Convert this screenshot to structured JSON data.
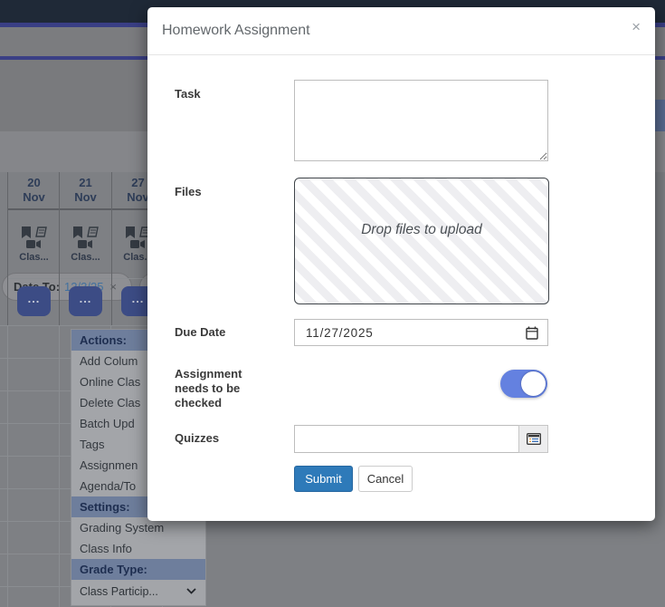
{
  "modal": {
    "title": "Homework Assignment",
    "close_label": "×",
    "task": {
      "label": "Task",
      "value": ""
    },
    "files": {
      "label": "Files",
      "dropzone_text": "Drop files to upload"
    },
    "due_date": {
      "label": "Due Date",
      "value": "11/27/2025"
    },
    "needs_check": {
      "label": "Assignment needs to be checked",
      "state": "on"
    },
    "quizzes": {
      "label": "Quizzes",
      "value": ""
    },
    "submit_label": "Submit",
    "cancel_label": "Cancel",
    "colors": {
      "primary": "#2e7ab9",
      "toggle_on": "#6481e0"
    }
  },
  "background": {
    "filter_chip": {
      "label": "Date To:",
      "value": "12/3/25",
      "remove": "×"
    },
    "columns": [
      {
        "day": "20",
        "month": "Nov",
        "class_label": "Clas...",
        "more": "..."
      },
      {
        "day": "21",
        "month": "Nov",
        "class_label": "Clas...",
        "more": "..."
      },
      {
        "day": "27",
        "month": "Nov",
        "class_label": "Clas...",
        "more": "..."
      }
    ],
    "menu": {
      "items": [
        {
          "label": "Actions:",
          "type": "header"
        },
        {
          "label": "Add Colum",
          "type": "item"
        },
        {
          "label": "Online Clas",
          "type": "item"
        },
        {
          "label": "Delete Clas",
          "type": "item"
        },
        {
          "label": "Batch Upd",
          "type": "item"
        },
        {
          "label": "Tags",
          "type": "item"
        },
        {
          "label": "Assignmen",
          "type": "item"
        },
        {
          "label": "Agenda/To",
          "type": "item"
        },
        {
          "label": "Settings:",
          "type": "header"
        },
        {
          "label": "Grading System",
          "type": "item"
        },
        {
          "label": "Class Info",
          "type": "item"
        },
        {
          "label": "Grade Type:",
          "type": "header"
        },
        {
          "label": "Class Particip...",
          "type": "select"
        }
      ]
    }
  }
}
